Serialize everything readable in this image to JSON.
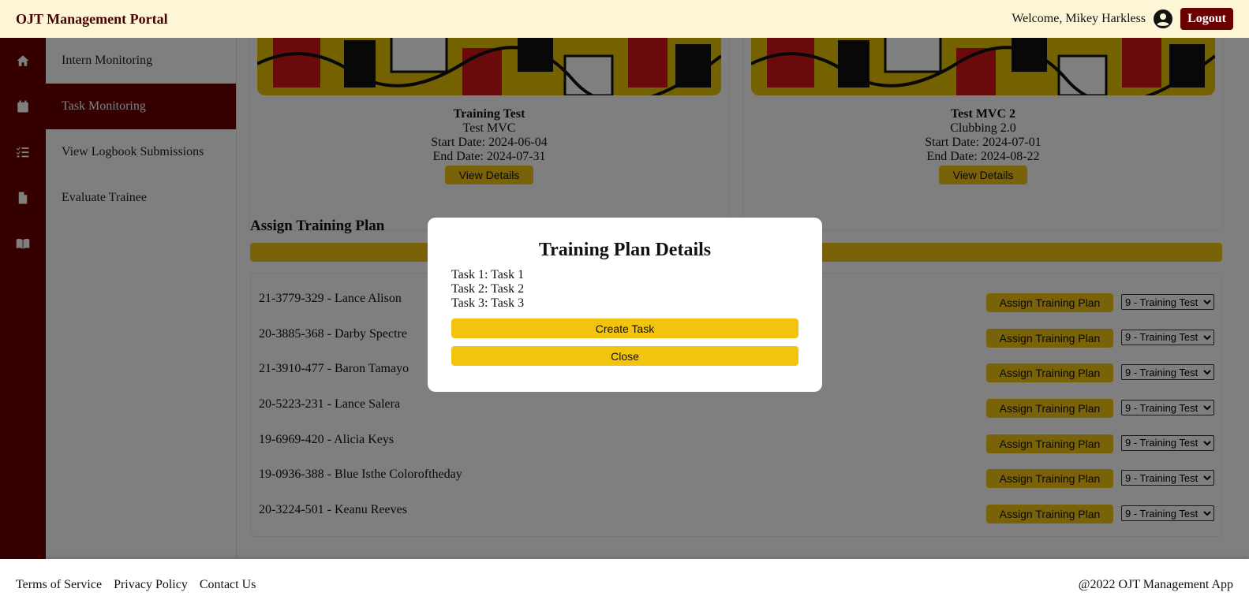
{
  "app": {
    "title": "OJT Management Portal"
  },
  "header": {
    "welcome": "Welcome, Mikey Harkless",
    "logout_label": "Logout",
    "user_icon": "account-circle-icon"
  },
  "sidebar": {
    "icons": [
      "home-icon",
      "calendar-icon",
      "checklist-icon",
      "document-icon",
      "book-icon"
    ],
    "items": [
      {
        "label": "Intern Monitoring",
        "active": false
      },
      {
        "label": "Task Monitoring",
        "active": true
      },
      {
        "label": "View Logbook Submissions",
        "active": false
      },
      {
        "label": "Evaluate Trainee",
        "active": false
      }
    ]
  },
  "training_plans": [
    {
      "title": "Training Test",
      "subtitle": "Test MVC",
      "start": "Start Date: 2024-06-04",
      "end": "End Date: 2024-07-31",
      "button": "View Details"
    },
    {
      "title": "Test MVC 2",
      "subtitle": "Clubbing 2.0",
      "start": "Start Date: 2024-07-01",
      "end": "End Date: 2024-08-22",
      "button": "View Details"
    }
  ],
  "assign_section": {
    "title": "Assign Training Plan",
    "assign_label": "Assign Training Plan",
    "selected_plan": "9 - Training Test",
    "interns": [
      "21-3779-329 - Lance Alison",
      "20-3885-368 - Darby Spectre",
      "21-3910-477 - Baron Tamayo",
      "20-5223-231 - Lance Salera",
      "19-6969-420 - Alicia Keys",
      "19-0936-388 - Blue Isthe Coloroftheday",
      "20-3224-501 - Keanu Reeves"
    ]
  },
  "modal": {
    "title": "Training Plan Details",
    "tasks": [
      "Task 1: Task 1",
      "Task 2: Task 2",
      "Task 3: Task 3"
    ],
    "create_label": "Create Task",
    "close_label": "Close"
  },
  "footer": {
    "links": [
      "Terms of Service",
      "Privacy Policy",
      "Contact Us"
    ],
    "copyright": "@2022 OJT Management App"
  },
  "colors": {
    "maroon": "#6b0000",
    "yellow": "#f2c40f",
    "header_bg": "#fdf6d6"
  }
}
